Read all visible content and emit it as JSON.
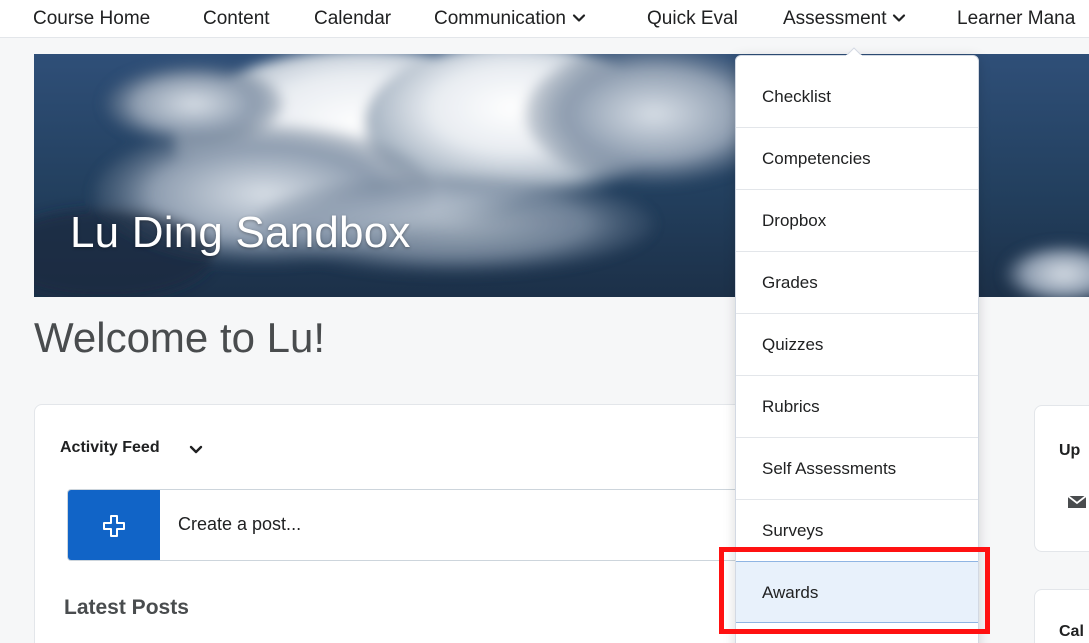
{
  "nav": {
    "items": [
      {
        "label": "Course Home"
      },
      {
        "label": "Content"
      },
      {
        "label": "Calendar"
      },
      {
        "label": "Communication"
      },
      {
        "label": "Quick Eval"
      },
      {
        "label": "Assessment"
      },
      {
        "label": "Learner Mana"
      }
    ]
  },
  "banner": {
    "title": "Lu Ding Sandbox"
  },
  "welcome": {
    "heading": "Welcome to Lu!"
  },
  "activity_feed": {
    "heading": "Activity Feed",
    "post_placeholder": "Create a post...",
    "latest_posts": "Latest Posts"
  },
  "right_cards": {
    "card1_label": "Up",
    "card2_label": "Cal"
  },
  "assessment_menu": {
    "items": [
      {
        "label": "Checklist"
      },
      {
        "label": "Competencies"
      },
      {
        "label": "Dropbox"
      },
      {
        "label": "Grades"
      },
      {
        "label": "Quizzes"
      },
      {
        "label": "Rubrics"
      },
      {
        "label": "Self Assessments"
      },
      {
        "label": "Surveys"
      },
      {
        "label": "Awards"
      }
    ],
    "active_item": "Awards"
  },
  "colors": {
    "primary": "#1164c7",
    "highlight": "#ff1111",
    "active_bg": "#e8f1fb"
  }
}
